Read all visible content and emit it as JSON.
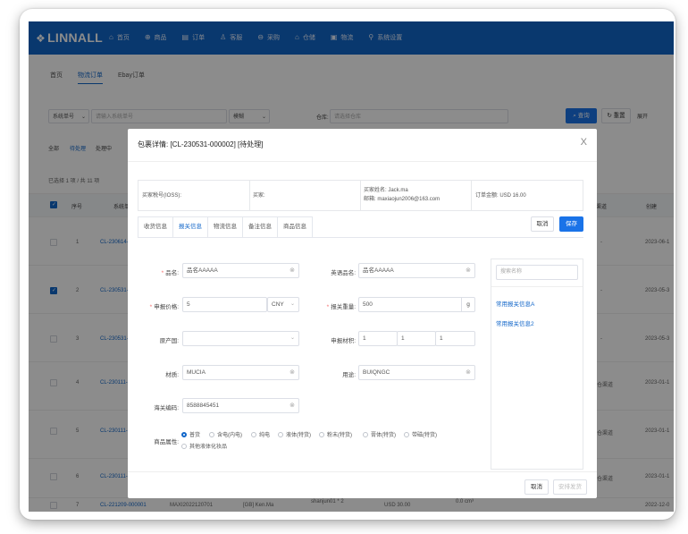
{
  "nav": {
    "logo": "LINNALL",
    "items": [
      {
        "icon": "home-icon",
        "glyph": "⌂",
        "label": "首页"
      },
      {
        "icon": "goods-icon",
        "glyph": "⊕",
        "label": "商品"
      },
      {
        "icon": "order-icon",
        "glyph": "▤",
        "label": "订单"
      },
      {
        "icon": "customer-icon",
        "glyph": "♙",
        "label": "客服"
      },
      {
        "icon": "purchase-icon",
        "glyph": "⊖",
        "label": "采购"
      },
      {
        "icon": "warehouse-icon",
        "glyph": "⌂",
        "label": "仓储"
      },
      {
        "icon": "logistics-icon",
        "glyph": "▣",
        "label": "物流"
      },
      {
        "icon": "settings-icon",
        "glyph": "⚲",
        "label": "系统设置"
      }
    ]
  },
  "page": {
    "tabs": [
      "首页",
      "物流订单",
      "Ebay订单"
    ],
    "filter": {
      "select1": "系统单号",
      "input1_placeholder": "请输入系统单号",
      "select2": "模糊",
      "warehouse_label": "仓库:",
      "warehouse_placeholder": "请选择仓库",
      "search_label": "查询",
      "reset_label": "重置",
      "expand_label": "展开"
    },
    "status_tabs": [
      "全部",
      "待处理",
      "处理中"
    ],
    "selected_text": "已选择 1 项 / 共 11 项",
    "columns": {
      "index": "序号",
      "sysno": "系统单",
      "channel": "渠道",
      "created": "创建"
    },
    "rows": [
      {
        "idx": "1",
        "no": "CL-230614-",
        "channel": "-",
        "date": "2023-06-1",
        "checked": false
      },
      {
        "idx": "2",
        "no": "CL-230531-",
        "channel": "-",
        "date": "2023-05-3",
        "checked": true
      },
      {
        "idx": "3",
        "no": "CL-230531-",
        "channel": "-",
        "date": "2023-05-3",
        "checked": false
      },
      {
        "idx": "4",
        "no": "CL-230111-",
        "channel": "无仓渠道",
        "date": "2023-01-1",
        "checked": false
      },
      {
        "idx": "5",
        "no": "CL-230111-",
        "channel": "无仓渠道",
        "date": "2023-01-1",
        "checked": false
      },
      {
        "idx": "6",
        "no": "CL-230111-",
        "channel": "无仓渠道",
        "date": "2023-01-1",
        "checked": false
      }
    ],
    "last_row": {
      "idx": "7",
      "no": "CL-221209-000001",
      "c2": "MAXI2022120701",
      "c3": "[GB] Ken.Ma",
      "c4": "shanjun01 * 2",
      "c5": "USD 30.00",
      "c6": "0.0 cm³",
      "date": "2022-12-0"
    }
  },
  "modal": {
    "title": "包裹详情: [CL-230531-000002] [待处理]",
    "close": "X",
    "info": {
      "buyer_tax": "买家税号(IOSS):",
      "buyer": "买家:",
      "buyer_name": "买家姓名: Jack.ma",
      "buyer_email": "邮箱: maxiaojun2006@163.com",
      "order_amount": "订单金额: USD 16.00"
    },
    "tabs": [
      "收货信息",
      "报关信息",
      "物流信息",
      "备注信息",
      "商品信息"
    ],
    "active_tab": 1,
    "cancel_label": "取消",
    "save_label": "保存",
    "form": {
      "name_label": "品名:",
      "name_value": "品名AAAAA",
      "en_name_label": "英语品名:",
      "en_name_value": "品名AAAAA",
      "price_label": "申报价格:",
      "price_value": "5",
      "currency": "CNY",
      "weight_label": "报关重量:",
      "weight_value": "500",
      "weight_unit": "g",
      "origin_label": "原产国:",
      "size_label": "申报材积:",
      "size_l": "1",
      "size_w": "1",
      "size_h": "1",
      "material_label": "材质:",
      "material_value": "MUCIA",
      "usage_label": "用途:",
      "usage_value": "BUIQNGC",
      "hs_label": "海关编码:",
      "hs_value": "8588845451",
      "attr_label": "商品属性:",
      "attrs": [
        "普货",
        "含电(内电)",
        "纯电",
        "液体(特货)",
        "粉末(特货)",
        "膏体(特货)",
        "带磁(特货)",
        "其他液体化妆品"
      ],
      "attr_selected": 0
    },
    "side": {
      "search_placeholder": "搜索名称",
      "items": [
        "常用报关信息A",
        "常用报关信息2"
      ]
    },
    "footer": {
      "cancel": "取消",
      "confirm": "安排发货"
    }
  }
}
